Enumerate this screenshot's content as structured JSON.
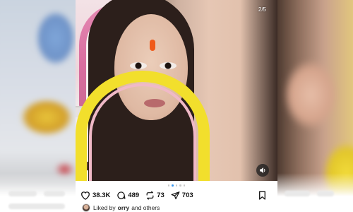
{
  "post": {
    "counter": "2/5",
    "likes": "38.3K",
    "comments": "489",
    "reposts": "73",
    "shares": "703",
    "liked_by_prefix": "Liked by",
    "liked_by_user": "orry",
    "liked_by_suffix": "and others"
  },
  "icons": {
    "like": "heart-icon",
    "comment": "comment-icon",
    "repost": "repost-icon",
    "share": "send-icon",
    "save": "bookmark-icon",
    "sound": "speaker-icon"
  },
  "colors": {
    "accent": "#3897f0",
    "text": "#111111"
  }
}
